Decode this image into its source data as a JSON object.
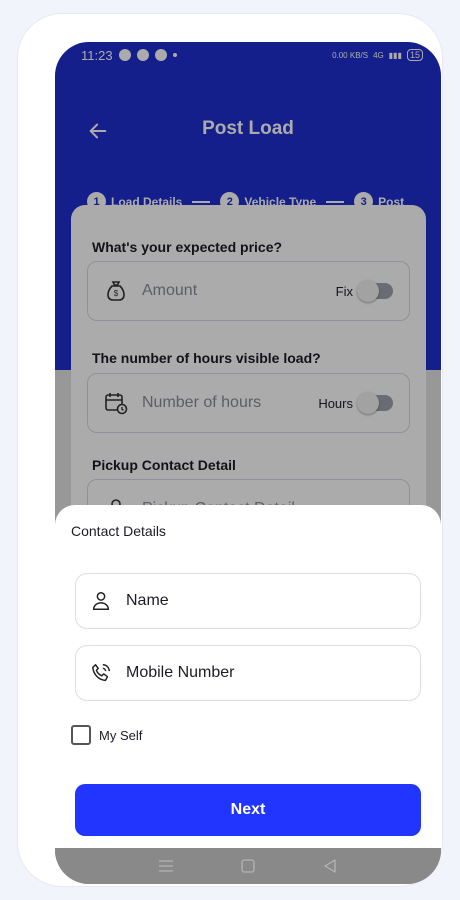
{
  "status_bar": {
    "time": "11:23",
    "speed": "0.00 KB/S",
    "network": "4G",
    "battery": "15"
  },
  "header": {
    "title": "Post Load",
    "steps": [
      {
        "number": "1",
        "label": "Load Details"
      },
      {
        "number": "2",
        "label": "Vehicle Type"
      },
      {
        "number": "3",
        "label": "Post"
      }
    ]
  },
  "form": {
    "price_label": "What's your expected price?",
    "price_placeholder": "Amount",
    "price_toggle_label": "Fix",
    "hours_label": "The number of hours visible load?",
    "hours_placeholder": "Number of hours",
    "hours_toggle_label": "Hours",
    "pickup_label": "Pickup Contact Detail",
    "pickup_placeholder": "Pickup Contact Detail"
  },
  "sheet": {
    "title": "Contact Details",
    "name_placeholder": "Name",
    "mobile_placeholder": "Mobile Number",
    "checkbox_label": "My Self",
    "next_button": "Next"
  },
  "colors": {
    "primary": "#1f2fcf",
    "button": "#2135ff"
  }
}
